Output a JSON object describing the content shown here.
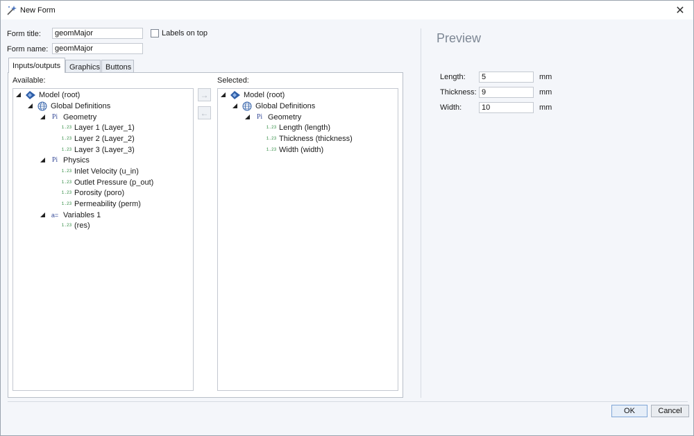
{
  "window": {
    "title": "New Form",
    "close_glyph": "✕"
  },
  "form": {
    "title_label": "Form title:",
    "title_value": "geomMajor",
    "name_label": "Form name:",
    "name_value": "geomMajor",
    "labels_on_top": "Labels on top"
  },
  "tabs": [
    "Inputs/outputs",
    "Graphics",
    "Buttons"
  ],
  "available": {
    "label": "Available:",
    "root": "Model (root)",
    "global": "Global Definitions",
    "geometry": "Geometry",
    "geometry_items": [
      "Layer 1 (Layer_1)",
      "Layer 2 (Layer_2)",
      "Layer 3 (Layer_3)"
    ],
    "physics": "Physics",
    "physics_items": [
      "Inlet Velocity (u_in)",
      "Outlet Pressure (p_out)",
      "Porosity (poro)",
      "Permeability (perm)"
    ],
    "variables": "Variables 1",
    "variables_items": [
      "(res)"
    ]
  },
  "selected": {
    "label": "Selected:",
    "root": "Model (root)",
    "global": "Global Definitions",
    "geometry": "Geometry",
    "items": [
      "Length (length)",
      "Thickness (thickness)",
      "Width (width)"
    ]
  },
  "icons": {
    "param": "1.23",
    "param_group": "Pi",
    "variables": "a="
  },
  "preview": {
    "title": "Preview",
    "fields": [
      {
        "label": "Length:",
        "value": "5",
        "unit": "mm"
      },
      {
        "label": "Thickness:",
        "value": "9",
        "unit": "mm"
      },
      {
        "label": "Width:",
        "value": "10",
        "unit": "mm"
      }
    ]
  },
  "buttons": {
    "ok": "OK",
    "cancel": "Cancel"
  },
  "colors": {
    "accent": "#7fa6d6",
    "param_green": "#2d8a3f",
    "model_blue": "#2f5fa8"
  }
}
